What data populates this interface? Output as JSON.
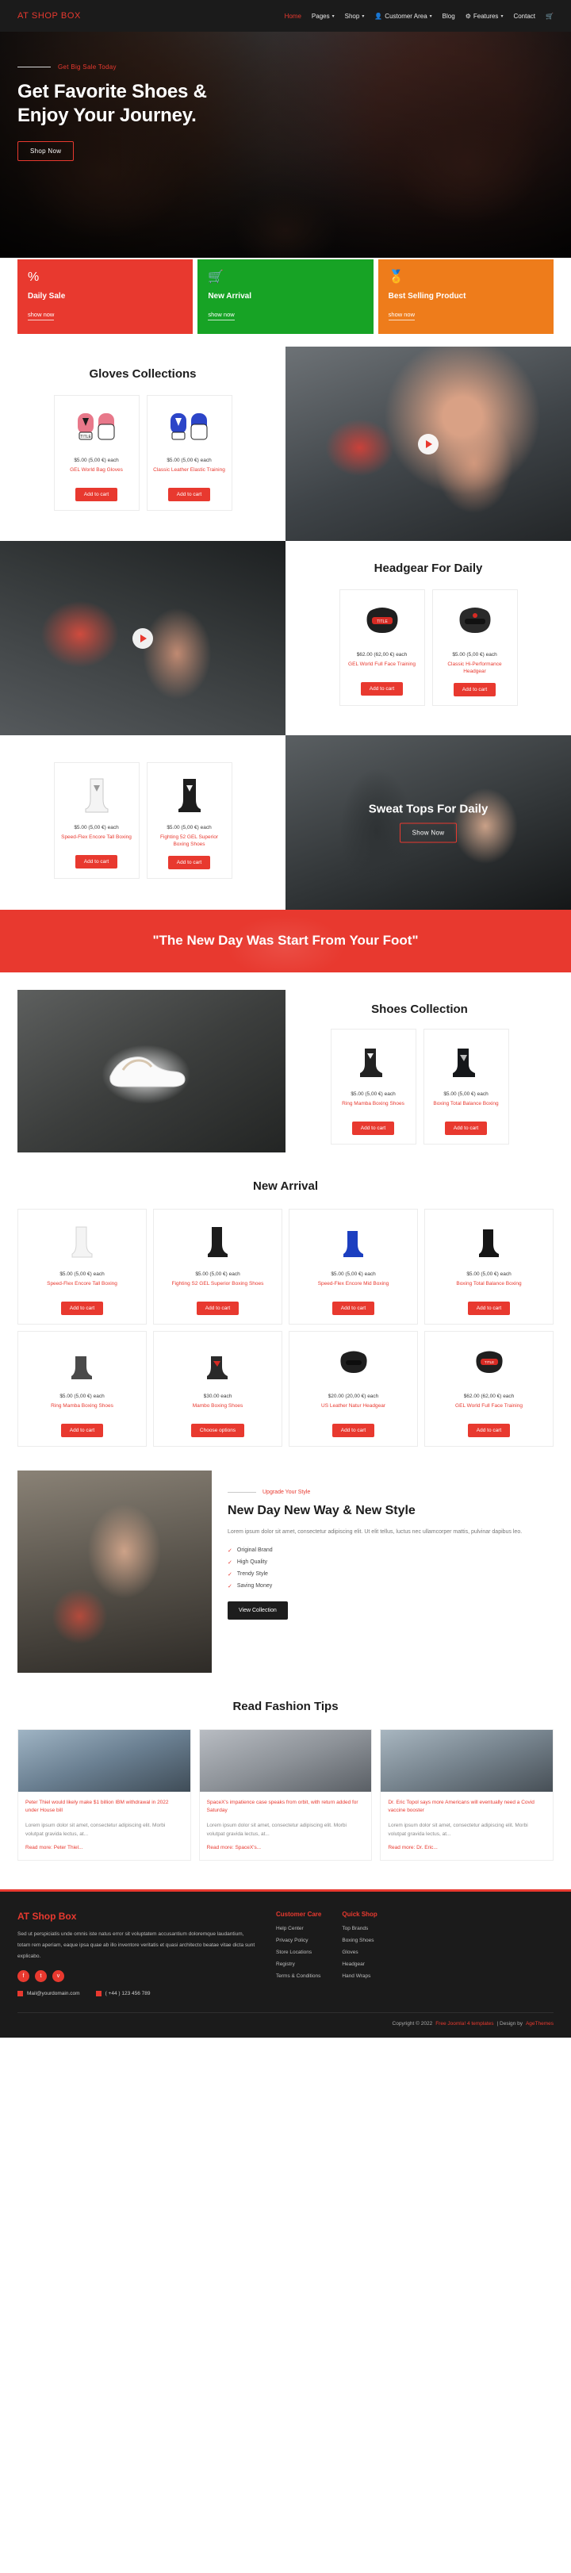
{
  "header": {
    "brand": "AT SHOP BOX",
    "nav": [
      {
        "label": "Home",
        "active": true,
        "caret": false,
        "icon": ""
      },
      {
        "label": "Pages",
        "active": false,
        "caret": true,
        "icon": ""
      },
      {
        "label": "Shop",
        "active": false,
        "caret": true,
        "icon": ""
      },
      {
        "label": "Customer Area",
        "active": false,
        "caret": true,
        "icon": "user-icon"
      },
      {
        "label": "Blog",
        "active": false,
        "caret": false,
        "icon": ""
      },
      {
        "label": "Features",
        "active": false,
        "caret": true,
        "icon": "gear-icon"
      },
      {
        "label": "Contact",
        "active": false,
        "caret": false,
        "icon": ""
      }
    ],
    "cart_icon": "cart-icon"
  },
  "hero": {
    "eyebrow": "Get Big Sale Today",
    "title": "Get Favorite Shoes & Enjoy Your Journey.",
    "button": "Shop Now"
  },
  "promos": [
    {
      "icon": "percent-icon",
      "glyph": "%",
      "title": "Daily Sale",
      "link": "show now",
      "color": "#e8392f"
    },
    {
      "icon": "basket-icon",
      "glyph": "\u0001",
      "title": "New Arrival",
      "link": "show now",
      "color": "#17a325"
    },
    {
      "icon": "medal-icon",
      "glyph": "\u0002",
      "title": "Best Selling Product",
      "link": "show now",
      "color": "#ee7c1b"
    }
  ],
  "gloves": {
    "title": "Gloves Collections",
    "products": [
      {
        "price": "$5.00 (5,00 €) each",
        "name": "GEL World Bag Gloves",
        "button": "Add to cart",
        "icon": "pink-boxing-gloves"
      },
      {
        "price": "$5.00 (5,00 €) each",
        "name": "Classic Leather Elastic Training",
        "button": "Add to cart",
        "icon": "blue-boxing-gloves"
      }
    ]
  },
  "headgear": {
    "title": "Headgear For Daily",
    "products": [
      {
        "price": "$62.00 (62,00 €) each",
        "name": "GEL World Full Face Training",
        "button": "Add to cart",
        "icon": "red-headgear"
      },
      {
        "price": "$5.00 (5,00 €) each",
        "name": "Classic Hi-Performance Headgear",
        "button": "Add to cart",
        "icon": "black-headgear"
      }
    ]
  },
  "boots": {
    "products": [
      {
        "price": "$5.00 (5,00 €) each",
        "name": "Speed-Flex Encore Tall Boxing",
        "button": "Add to cart",
        "icon": "white-boxing-boot"
      },
      {
        "price": "$5.00 (5,00 €) each",
        "name": "Fighting 52 GEL Superior Boxing Shoes",
        "button": "Add to cart",
        "icon": "black-boxing-boot"
      }
    ]
  },
  "sweat": {
    "title": "Sweat Tops For Daily",
    "button": "Show Now"
  },
  "quote": {
    "text": "\"The New Day Was Start From Your Foot\""
  },
  "shoes": {
    "title": "Shoes Collection",
    "products": [
      {
        "price": "$5.00 (5,00 €) each",
        "name": "Ring Mamba Boxing Shoes",
        "button": "Add to cart",
        "icon": "black-high-top"
      },
      {
        "price": "$5.00 (5,00 €) each",
        "name": "Boxing Total Balance Boxing",
        "button": "Add to cart",
        "icon": "dark-boxing-shoe"
      }
    ]
  },
  "new_arrival": {
    "title": "New Arrival",
    "products": [
      {
        "price": "$5.00 (5,00 €) each",
        "name": "Speed-Flex Encore Tall Boxing",
        "button": "Add to cart",
        "icon": "white-tall-boot"
      },
      {
        "price": "$5.00 (5,00 €) each",
        "name": "Fighting S2 GEL Superior Boxing Shoes",
        "button": "Add to cart",
        "icon": "black-tall-boot"
      },
      {
        "price": "$5.00 (5,00 €) each",
        "name": "Speed-Flex Encore Mid Boxing",
        "button": "Add to cart",
        "icon": "blue-mid-boot"
      },
      {
        "price": "$5.00 (5,00 €) each",
        "name": "Boxing Total Balance Boxing",
        "button": "Add to cart",
        "icon": "black-mid-boot"
      },
      {
        "price": "$5.00 (5,00 €) each",
        "name": "Ring Mamba Boxing Shoes",
        "button": "Add to cart",
        "icon": "grey-boxing-shoe"
      },
      {
        "price": "$30.00 each",
        "name": "Mambo Boxing Shoes",
        "button": "Choose options",
        "icon": "red-boxing-shoe"
      },
      {
        "price": "$20.00 (20,00 €) each",
        "name": "US Leather Natur Headgear",
        "button": "Add to cart",
        "icon": "black-headgear-2"
      },
      {
        "price": "$62.00 (62,00 €) each",
        "name": "GEL World Full Face Training",
        "button": "Add to cart",
        "icon": "red-headgear-2"
      }
    ]
  },
  "feature": {
    "eyebrow": "Upgrade Your Style",
    "title": "New Day New Way & New Style",
    "lead": "Lorem ipsum dolor sit amet, consectetur adipiscing elit. Ut elit tellus, luctus nec ullamcorper mattis, pulvinar dapibus leo.",
    "bullets": [
      "Original Brand",
      "High Quality",
      "Trendy Style",
      "Saving Money"
    ],
    "button": "View Collection"
  },
  "blog": {
    "title": "Read Fashion Tips",
    "posts": [
      {
        "title": "Peter Thiel would likely make $1 billion IBM withdrawal in 2022 under House bill",
        "excerpt": "Lorem ipsum dolor sit amet, consectetur adipiscing elit. Morbi volutpat gravida lectus, at...",
        "more": "Read more: Peter Thiel..."
      },
      {
        "title": "SpaceX's impatience case speaks from orbit, with return added for Saturday",
        "excerpt": "Lorem ipsum dolor sit amet, consectetur adipiscing elit. Morbi volutpat gravida lectus, at...",
        "more": "Read more: SpaceX's..."
      },
      {
        "title": "Dr. Eric Topol says more Americans will eventually need a Covid vaccine booster",
        "excerpt": "Lorem ipsum dolor sit amet, consectetur adipiscing elit. Morbi volutpat gravida lectus, at...",
        "more": "Read more: Dr. Eric..."
      }
    ]
  },
  "footer": {
    "brand": "AT Shop Box",
    "about": "Sed ut perspiciatis unde omnis iste natus error sit voluptatem accusantium doloremque laudantium, totam rem aperiam, eaque ipsa quae ab illo inventore veritatis et quasi architecto beatae vitae dicta sunt explicabo.",
    "socials": [
      "facebook-icon",
      "twitter-icon",
      "vimeo-icon"
    ],
    "email": "Mail@yourdomain.com",
    "phone": "( +44 ) 123 456 789",
    "columns": [
      {
        "title": "Customer Care",
        "items": [
          "Help Center",
          "Privacy Policy",
          "Store Locations",
          "Registry",
          "Terms & Conditions"
        ]
      },
      {
        "title": "Quick Shop",
        "items": [
          "Top Brands",
          "Boxing Shoes",
          "Gloves",
          "Headgear",
          "Hand Wraps"
        ]
      }
    ],
    "copyright_prefix": "Copyright © 2022",
    "copyright_link": "Free Joomla! 4 templates",
    "design_prefix": "| Design by",
    "design_link": "AgeThemes"
  }
}
